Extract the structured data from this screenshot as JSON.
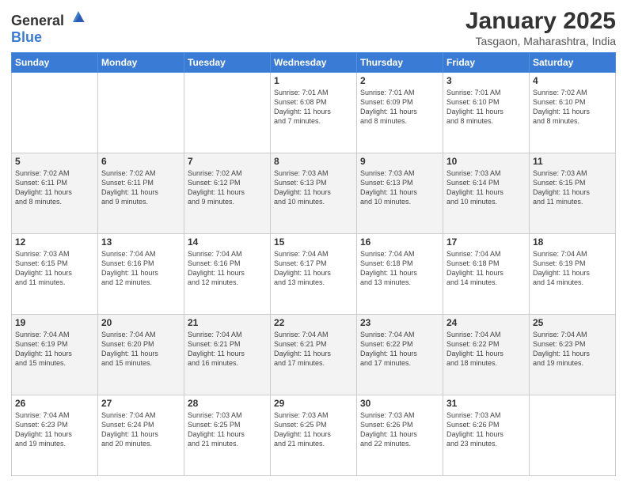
{
  "logo": {
    "general": "General",
    "blue": "Blue"
  },
  "header": {
    "title": "January 2025",
    "subtitle": "Tasgaon, Maharashtra, India"
  },
  "weekdays": [
    "Sunday",
    "Monday",
    "Tuesday",
    "Wednesday",
    "Thursday",
    "Friday",
    "Saturday"
  ],
  "weeks": [
    [
      {
        "day": "",
        "info": ""
      },
      {
        "day": "",
        "info": ""
      },
      {
        "day": "",
        "info": ""
      },
      {
        "day": "1",
        "info": "Sunrise: 7:01 AM\nSunset: 6:08 PM\nDaylight: 11 hours\nand 7 minutes."
      },
      {
        "day": "2",
        "info": "Sunrise: 7:01 AM\nSunset: 6:09 PM\nDaylight: 11 hours\nand 8 minutes."
      },
      {
        "day": "3",
        "info": "Sunrise: 7:01 AM\nSunset: 6:10 PM\nDaylight: 11 hours\nand 8 minutes."
      },
      {
        "day": "4",
        "info": "Sunrise: 7:02 AM\nSunset: 6:10 PM\nDaylight: 11 hours\nand 8 minutes."
      }
    ],
    [
      {
        "day": "5",
        "info": "Sunrise: 7:02 AM\nSunset: 6:11 PM\nDaylight: 11 hours\nand 8 minutes."
      },
      {
        "day": "6",
        "info": "Sunrise: 7:02 AM\nSunset: 6:11 PM\nDaylight: 11 hours\nand 9 minutes."
      },
      {
        "day": "7",
        "info": "Sunrise: 7:02 AM\nSunset: 6:12 PM\nDaylight: 11 hours\nand 9 minutes."
      },
      {
        "day": "8",
        "info": "Sunrise: 7:03 AM\nSunset: 6:13 PM\nDaylight: 11 hours\nand 10 minutes."
      },
      {
        "day": "9",
        "info": "Sunrise: 7:03 AM\nSunset: 6:13 PM\nDaylight: 11 hours\nand 10 minutes."
      },
      {
        "day": "10",
        "info": "Sunrise: 7:03 AM\nSunset: 6:14 PM\nDaylight: 11 hours\nand 10 minutes."
      },
      {
        "day": "11",
        "info": "Sunrise: 7:03 AM\nSunset: 6:15 PM\nDaylight: 11 hours\nand 11 minutes."
      }
    ],
    [
      {
        "day": "12",
        "info": "Sunrise: 7:03 AM\nSunset: 6:15 PM\nDaylight: 11 hours\nand 11 minutes."
      },
      {
        "day": "13",
        "info": "Sunrise: 7:04 AM\nSunset: 6:16 PM\nDaylight: 11 hours\nand 12 minutes."
      },
      {
        "day": "14",
        "info": "Sunrise: 7:04 AM\nSunset: 6:16 PM\nDaylight: 11 hours\nand 12 minutes."
      },
      {
        "day": "15",
        "info": "Sunrise: 7:04 AM\nSunset: 6:17 PM\nDaylight: 11 hours\nand 13 minutes."
      },
      {
        "day": "16",
        "info": "Sunrise: 7:04 AM\nSunset: 6:18 PM\nDaylight: 11 hours\nand 13 minutes."
      },
      {
        "day": "17",
        "info": "Sunrise: 7:04 AM\nSunset: 6:18 PM\nDaylight: 11 hours\nand 14 minutes."
      },
      {
        "day": "18",
        "info": "Sunrise: 7:04 AM\nSunset: 6:19 PM\nDaylight: 11 hours\nand 14 minutes."
      }
    ],
    [
      {
        "day": "19",
        "info": "Sunrise: 7:04 AM\nSunset: 6:19 PM\nDaylight: 11 hours\nand 15 minutes."
      },
      {
        "day": "20",
        "info": "Sunrise: 7:04 AM\nSunset: 6:20 PM\nDaylight: 11 hours\nand 15 minutes."
      },
      {
        "day": "21",
        "info": "Sunrise: 7:04 AM\nSunset: 6:21 PM\nDaylight: 11 hours\nand 16 minutes."
      },
      {
        "day": "22",
        "info": "Sunrise: 7:04 AM\nSunset: 6:21 PM\nDaylight: 11 hours\nand 17 minutes."
      },
      {
        "day": "23",
        "info": "Sunrise: 7:04 AM\nSunset: 6:22 PM\nDaylight: 11 hours\nand 17 minutes."
      },
      {
        "day": "24",
        "info": "Sunrise: 7:04 AM\nSunset: 6:22 PM\nDaylight: 11 hours\nand 18 minutes."
      },
      {
        "day": "25",
        "info": "Sunrise: 7:04 AM\nSunset: 6:23 PM\nDaylight: 11 hours\nand 19 minutes."
      }
    ],
    [
      {
        "day": "26",
        "info": "Sunrise: 7:04 AM\nSunset: 6:23 PM\nDaylight: 11 hours\nand 19 minutes."
      },
      {
        "day": "27",
        "info": "Sunrise: 7:04 AM\nSunset: 6:24 PM\nDaylight: 11 hours\nand 20 minutes."
      },
      {
        "day": "28",
        "info": "Sunrise: 7:03 AM\nSunset: 6:25 PM\nDaylight: 11 hours\nand 21 minutes."
      },
      {
        "day": "29",
        "info": "Sunrise: 7:03 AM\nSunset: 6:25 PM\nDaylight: 11 hours\nand 21 minutes."
      },
      {
        "day": "30",
        "info": "Sunrise: 7:03 AM\nSunset: 6:26 PM\nDaylight: 11 hours\nand 22 minutes."
      },
      {
        "day": "31",
        "info": "Sunrise: 7:03 AM\nSunset: 6:26 PM\nDaylight: 11 hours\nand 23 minutes."
      },
      {
        "day": "",
        "info": ""
      }
    ]
  ]
}
